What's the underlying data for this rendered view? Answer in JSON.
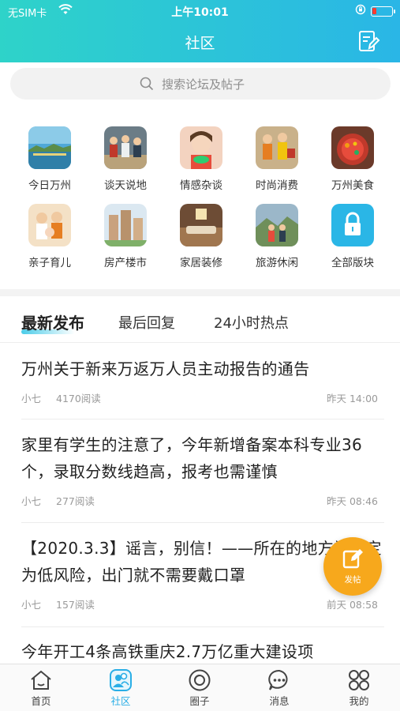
{
  "status": {
    "carrier": "无SIM卡",
    "time": "上午10:01"
  },
  "header": {
    "title": "社区"
  },
  "search": {
    "placeholder": "搜索论坛及帖子"
  },
  "forums": [
    {
      "label": "今日万州",
      "icon": "today-wanzhou-image"
    },
    {
      "label": "谈天说地",
      "icon": "chat-image"
    },
    {
      "label": "情感杂谈",
      "icon": "emotion-image"
    },
    {
      "label": "时尚消费",
      "icon": "fashion-image"
    },
    {
      "label": "万州美食",
      "icon": "food-image"
    },
    {
      "label": "亲子育儿",
      "icon": "parenting-image"
    },
    {
      "label": "房产楼市",
      "icon": "realestate-image"
    },
    {
      "label": "家居装修",
      "icon": "home-decor-image"
    },
    {
      "label": "旅游休闲",
      "icon": "travel-image"
    },
    {
      "label": "全部版块",
      "icon": "lock-icon"
    }
  ],
  "tabs": [
    "最新发布",
    "最后回复",
    "24小时热点"
  ],
  "posts": [
    {
      "title": "万州关于新来万返万人员主动报告的通告",
      "author": "小七",
      "reads": "4170阅读",
      "time": "昨天 14:00"
    },
    {
      "title": "家里有学生的注意了，今年新增备案本科专业36个，录取分数线趋高，报考也需谨慎",
      "author": "小七",
      "reads": "277阅读",
      "time": "昨天 08:46"
    },
    {
      "title": "【2020.3.3】谣言，别信！——所在的地方被认定为低风险，出门就不需要戴口罩",
      "author": "小七",
      "reads": "157阅读",
      "time": "前天 08:58"
    },
    {
      "title": "今年开工4条高铁重庆2.7万亿重大建设项",
      "author": "",
      "reads": "",
      "time": ""
    }
  ],
  "fab": {
    "label": "发帖"
  },
  "tabbar": [
    {
      "label": "首页",
      "icon": "home-icon"
    },
    {
      "label": "社区",
      "icon": "community-icon"
    },
    {
      "label": "圈子",
      "icon": "circle-icon"
    },
    {
      "label": "消息",
      "icon": "message-icon"
    },
    {
      "label": "我的",
      "icon": "grid-icon"
    }
  ],
  "colors": {
    "accent": "#2aaee6",
    "header_gradient_start": "#2ed3c9",
    "fab": "#f7a81c"
  }
}
